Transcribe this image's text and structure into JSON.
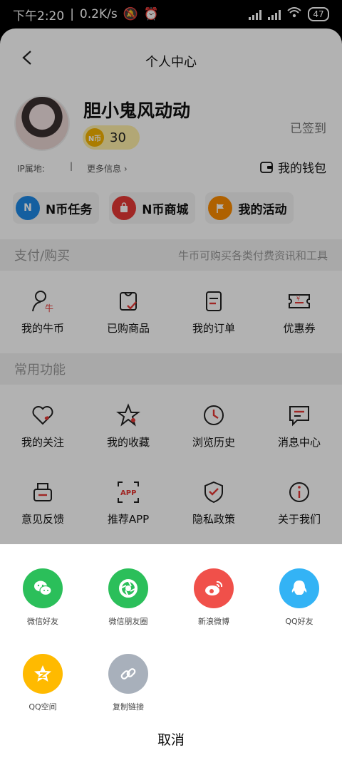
{
  "status_bar": {
    "time": "下午2:20",
    "speed": "0.2K/s",
    "battery": "47"
  },
  "header": {
    "title": "个人中心"
  },
  "profile": {
    "username": "胆小鬼风动动",
    "coin_badge": "N币",
    "coins": "30",
    "signin": "已签到",
    "ip_label": "IP属地:",
    "separator": "|",
    "more_info": "更多信息 ›",
    "wallet": "我的钱包"
  },
  "quick_actions": [
    {
      "label": "N币任务",
      "icon_text": "N",
      "color": "#1e88e5"
    },
    {
      "label": "N币商城",
      "icon_text": "",
      "color": "#e53935"
    },
    {
      "label": "我的活动",
      "icon_text": "",
      "color": "#fb8c00"
    }
  ],
  "payment_section": {
    "title": "支付/购买",
    "subtitle": "牛币可购买各类付费资讯和工具",
    "items": [
      "我的牛币",
      "已购商品",
      "我的订单",
      "优惠券"
    ]
  },
  "common_section": {
    "title": "常用功能",
    "row1": [
      "我的关注",
      "我的收藏",
      "浏览历史",
      "消息中心"
    ],
    "row2": [
      "意见反馈",
      "推荐APP",
      "隐私政策",
      "关于我们"
    ]
  },
  "share_sheet": {
    "row1": [
      {
        "label": "微信好友",
        "icon": "wechat-icon",
        "color": "#2bbf5a"
      },
      {
        "label": "微信朋友圈",
        "icon": "moments-icon",
        "color": "#2bbf5a"
      },
      {
        "label": "新浪微博",
        "icon": "weibo-icon",
        "color": "#f0504a"
      },
      {
        "label": "QQ好友",
        "icon": "qq-icon",
        "color": "#33b3f5"
      }
    ],
    "row2": [
      {
        "label": "QQ空间",
        "icon": "qzone-icon",
        "color": "#ffba00"
      },
      {
        "label": "复制链接",
        "icon": "link-icon",
        "color": "#a8b0bb"
      }
    ],
    "cancel": "取消"
  }
}
